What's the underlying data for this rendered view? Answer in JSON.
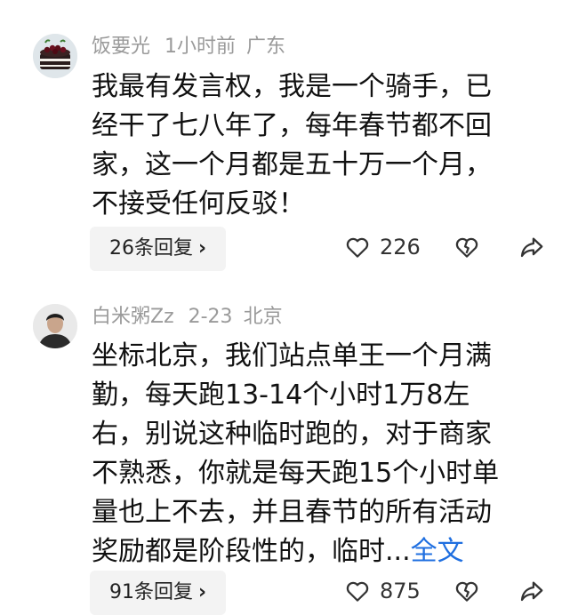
{
  "comments": [
    {
      "username": "饭要光",
      "time": "1小时前",
      "location": "广东",
      "avatar_icon": "cake-avatar",
      "text_lines": [
        "我最有发言权，我是一个骑手，已",
        "经干了七八年了，每年春节都不回",
        "家，这一个月都是五十万一个月，",
        "不接受任何反驳！"
      ],
      "replies_label": "26条回复",
      "likes": "226"
    },
    {
      "username": "白米粥Zz",
      "time": "2-23",
      "location": "北京",
      "avatar_icon": "person-avatar",
      "text_lines": [
        "坐标北京，我们站点单王一个月满",
        "勤，每天跑13-14个小时1万8左",
        "右，别说这种临时跑的，对于商家",
        "不熟悉，你就是每天跑15个小时单",
        "量也上不去，并且春节的所有活动",
        "奖励都是阶段性的，临时..."
      ],
      "more_label": "全文",
      "replies_label": "91条回复",
      "likes": "875"
    }
  ],
  "icons": {
    "chevron": "›",
    "like": "heart-icon",
    "dislike": "broken-heart-icon",
    "share": "share-icon"
  },
  "colors": {
    "meta_text": "#9a9a9a",
    "link": "#1f6fe0",
    "pill_bg": "#f3f3f3"
  }
}
